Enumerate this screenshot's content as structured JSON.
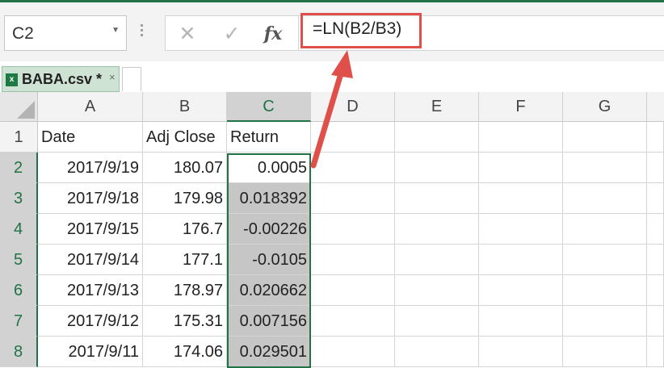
{
  "name_box": {
    "value": "C2",
    "dropdown_icon": "chevron-down-icon"
  },
  "formula_bar": {
    "cancel_icon": "cross-icon",
    "confirm_icon": "check-icon",
    "insert_function_label": "fx",
    "formula": "=LN(B2/B3)",
    "highlight_color": "#e0504a"
  },
  "sheet_tab": {
    "label": "BABA.csv *",
    "icon": "excel-file-icon",
    "close_label": "×"
  },
  "columns": [
    "A",
    "B",
    "C",
    "D",
    "E",
    "F",
    "G"
  ],
  "rows": [
    {
      "num": "1",
      "a": "Date",
      "b": "Adj Close",
      "c": "Return"
    },
    {
      "num": "2",
      "a": "2017/9/19",
      "b": "180.07",
      "c": "0.0005"
    },
    {
      "num": "3",
      "a": "2017/9/18",
      "b": "179.98",
      "c": "0.018392"
    },
    {
      "num": "4",
      "a": "2017/9/15",
      "b": "176.7",
      "c": "-0.00226"
    },
    {
      "num": "5",
      "a": "2017/9/14",
      "b": "177.1",
      "c": "-0.0105"
    },
    {
      "num": "6",
      "a": "2017/9/13",
      "b": "178.97",
      "c": "0.020662"
    },
    {
      "num": "7",
      "a": "2017/9/12",
      "b": "175.31",
      "c": "0.007156"
    },
    {
      "num": "8",
      "a": "2017/9/11",
      "b": "174.06",
      "c": "0.029501"
    }
  ],
  "selection": {
    "active_cell": "C2",
    "range": "C2:C8",
    "accent_color": "#217346"
  }
}
